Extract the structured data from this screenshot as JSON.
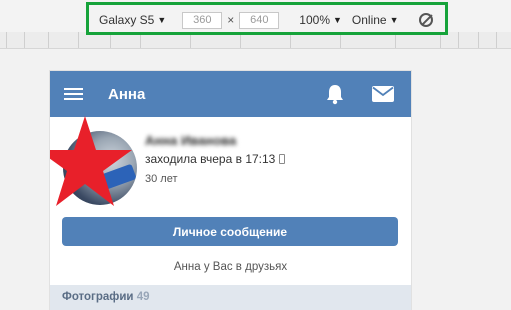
{
  "devtools": {
    "device": "Galaxy S5",
    "width": "360",
    "height": "640",
    "times": "×",
    "zoom": "100%",
    "network": "Online",
    "caret": "▼"
  },
  "header": {
    "title": "Анна"
  },
  "profile": {
    "name_prefix": "Анна",
    "name_obscured": "Иванова",
    "last_seen": "заходила вчера в 17:13",
    "age": "30 лет",
    "message_button": "Личное сообщение",
    "friends_status": "Анна у Вас в друзьях"
  },
  "photos": {
    "title": "Фотографии",
    "count": "49"
  },
  "colors": {
    "brand": "#5181b8",
    "highlight": "#16a33a",
    "star": "#e8202a"
  },
  "icons": [
    "menu-icon",
    "bell-icon",
    "mail-icon",
    "star-icon",
    "mobile-icon",
    "rotate-icon"
  ]
}
